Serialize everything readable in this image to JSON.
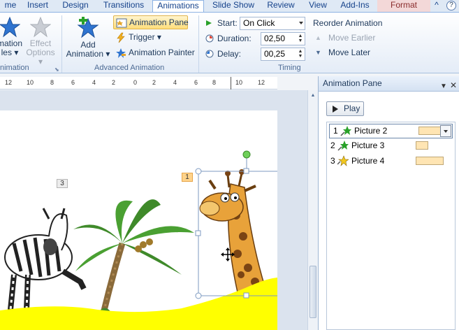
{
  "tabs": [
    {
      "label": "me"
    },
    {
      "label": "Insert"
    },
    {
      "label": "Design"
    },
    {
      "label": "Transitions"
    },
    {
      "label": "Animations"
    },
    {
      "label": "Slide Show"
    },
    {
      "label": "Review"
    },
    {
      "label": "View"
    },
    {
      "label": "Add-Ins"
    },
    {
      "label": "Format"
    }
  ],
  "help_label": "?",
  "ribbon": {
    "animation_styles": {
      "line1": "mation",
      "line2": "les ▾"
    },
    "effect_options": {
      "line1": "Effect",
      "line2": "Options ▾"
    },
    "group_animation": "nimation",
    "add_animation": {
      "line1": "Add",
      "line2": "Animation ▾"
    },
    "animation_pane": "Animation Pane",
    "trigger": "Trigger ▾",
    "animation_painter": "Animation Painter",
    "group_advanced": "Advanced Animation",
    "start_label": "Start:",
    "start_value": "On Click",
    "duration_label": "Duration:",
    "duration_value": "02,50",
    "delay_label": "Delay:",
    "delay_value": "00,25",
    "group_timing": "Timing",
    "reorder_title": "Reorder Animation",
    "move_earlier": "Move Earlier",
    "move_later": "Move Later"
  },
  "ruler": {
    "labels": [
      "12",
      "10",
      "8",
      "6",
      "4",
      "2",
      "0",
      "2",
      "4",
      "6",
      "8",
      "10",
      "12"
    ]
  },
  "slide_tags": {
    "zebra": "3",
    "giraffe": "1"
  },
  "pane": {
    "title": "Animation Pane",
    "play_label": "Play",
    "items": [
      {
        "num": "1",
        "name": "Picture 2"
      },
      {
        "num": "2",
        "name": "Picture 3"
      },
      {
        "num": "3",
        "name": "Picture 4"
      }
    ]
  }
}
